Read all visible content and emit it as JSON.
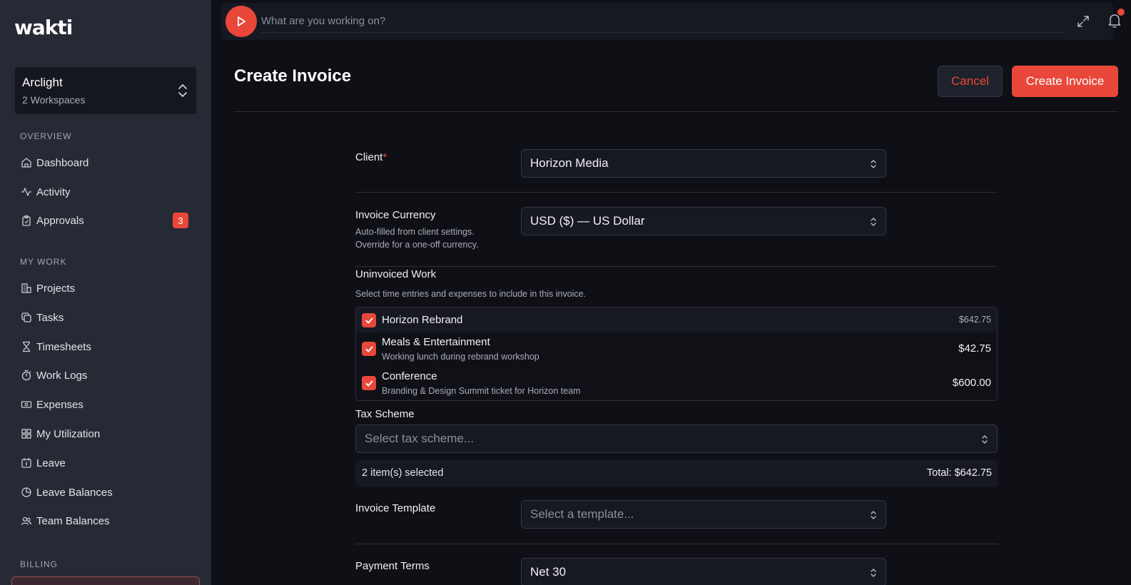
{
  "app": {
    "logo": "wakti"
  },
  "workspace": {
    "name": "Arclight",
    "sub": "2 Workspaces"
  },
  "sidebar": {
    "sections": [
      {
        "label": "OVERVIEW"
      },
      {
        "label": "MY WORK"
      },
      {
        "label": "BILLING"
      }
    ],
    "items": [
      {
        "label": "Dashboard",
        "icon": "home-icon"
      },
      {
        "label": "Activity",
        "icon": "activity-icon"
      },
      {
        "label": "Approvals",
        "icon": "clipboard-icon",
        "badge": "3"
      },
      {
        "label": "Projects",
        "icon": "building-icon"
      },
      {
        "label": "Tasks",
        "icon": "tasks-icon"
      },
      {
        "label": "Timesheets",
        "icon": "hourglass-icon"
      },
      {
        "label": "Work Logs",
        "icon": "stopwatch-icon"
      },
      {
        "label": "Expenses",
        "icon": "banknote-icon"
      },
      {
        "label": "My Utilization",
        "icon": "grid-icon"
      },
      {
        "label": "Leave",
        "icon": "calendar-icon"
      },
      {
        "label": "Leave Balances",
        "icon": "pie-icon"
      },
      {
        "label": "Team Balances",
        "icon": "users-icon"
      }
    ]
  },
  "timer": {
    "placeholder": "What are you working on?"
  },
  "header": {
    "title": "Create Invoice",
    "cancel": "Cancel",
    "create": "Create Invoice"
  },
  "form": {
    "client": {
      "label": "Client",
      "required": "*",
      "value": "Horizon Media"
    },
    "currency": {
      "label": "Invoice Currency",
      "help1": "Auto-filled from client settings.",
      "help2": "Override for a one-off currency.",
      "value": "USD ($) — US Dollar"
    },
    "uninvoiced": {
      "label": "Uninvoiced Work",
      "help": "Select time entries and expenses to include in this invoice.",
      "group": {
        "title": "Horizon Rebrand",
        "amount": "$642.75"
      },
      "rows": [
        {
          "title": "Meals & Entertainment",
          "sub": "Working lunch during rebrand workshop",
          "amount": "$42.75"
        },
        {
          "title": "Conference",
          "sub": "Branding & Design Summit ticket for Horizon team",
          "amount": "$600.00"
        }
      ]
    },
    "tax": {
      "label": "Tax Scheme",
      "placeholder": "Select tax scheme..."
    },
    "summary": {
      "selected": "2 item(s) selected",
      "total": "Total: $642.75"
    },
    "template": {
      "label": "Invoice Template",
      "placeholder": "Select a template..."
    },
    "terms": {
      "label": "Payment Terms",
      "value": "Net 30"
    }
  },
  "colors": {
    "accent": "#e8473a",
    "sidebar": "#262a35",
    "background": "#0e1015"
  }
}
